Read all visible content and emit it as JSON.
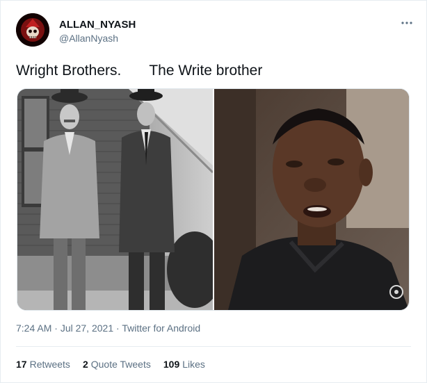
{
  "author": {
    "name": "ALLAN_NYASH",
    "handle": "@AllanNyash",
    "avatar_icon": "skull-avatar-icon"
  },
  "more_icon": "more-options-icon",
  "tweet": {
    "text_left": "Wright Brothers.",
    "text_right": "The Write brother"
  },
  "media": {
    "left_photo": "vintage-photo-two-men",
    "right_photo": "man-speaking-photo"
  },
  "meta": {
    "time": "7:24 AM",
    "date": "Jul 27, 2021",
    "source": "Twitter for Android"
  },
  "stats": {
    "retweets_count": "17",
    "retweets_label": "Retweets",
    "quotes_count": "2",
    "quotes_label": "Quote Tweets",
    "likes_count": "109",
    "likes_label": "Likes"
  },
  "colors": {
    "text_primary": "#0f1419",
    "text_secondary": "#5b7083",
    "border": "#e6ecf0"
  }
}
